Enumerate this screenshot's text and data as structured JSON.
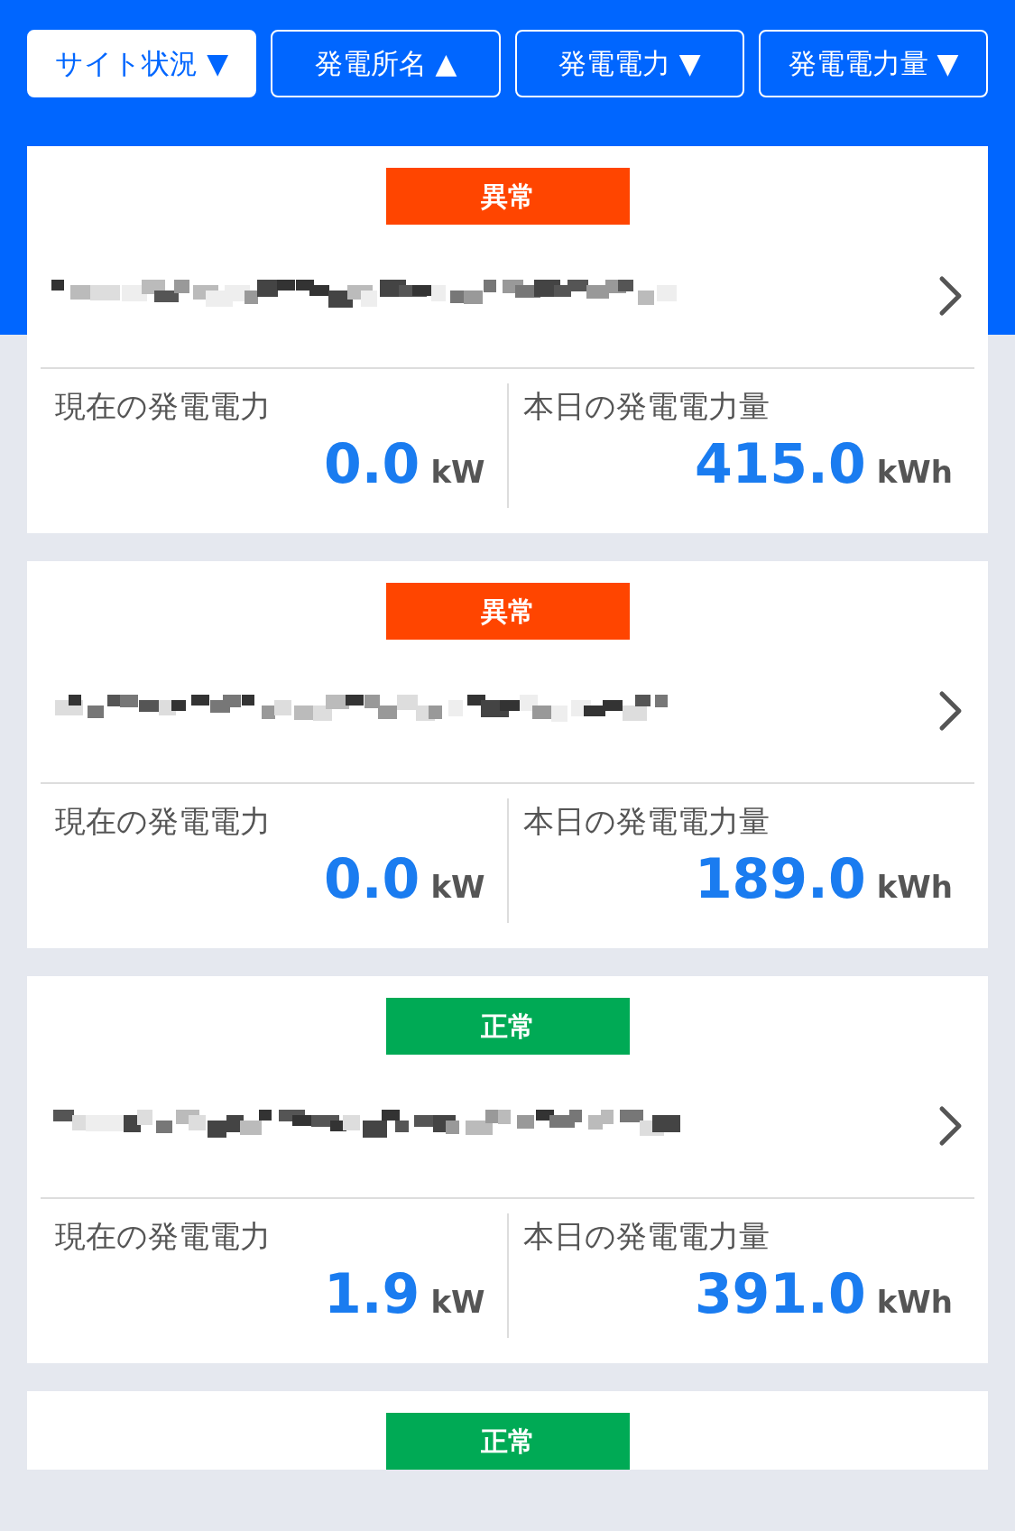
{
  "sort_buttons": [
    {
      "label": "サイト状況",
      "arrow": "▼",
      "selected": true
    },
    {
      "label": "発電所名",
      "arrow": "▲",
      "selected": false
    },
    {
      "label": "発電電力",
      "arrow": "▼",
      "selected": false
    },
    {
      "label": "発電電力量",
      "arrow": "▼",
      "selected": false
    }
  ],
  "sites": [
    {
      "status": {
        "kind": "error",
        "label": "異常"
      },
      "current_label": "現在の発電電力",
      "current_value": "0.0",
      "current_unit": "kW",
      "today_label": "本日の発電電力量",
      "today_value": "415.0",
      "today_unit": "kWh"
    },
    {
      "status": {
        "kind": "error",
        "label": "異常"
      },
      "current_label": "現在の発電電力",
      "current_value": "0.0",
      "current_unit": "kW",
      "today_label": "本日の発電電力量",
      "today_value": "189.0",
      "today_unit": "kWh"
    },
    {
      "status": {
        "kind": "normal",
        "label": "正常"
      },
      "current_label": "現在の発電電力",
      "current_value": "1.9",
      "current_unit": "kW",
      "today_label": "本日の発電電力量",
      "today_value": "391.0",
      "today_unit": "kWh"
    },
    {
      "status": {
        "kind": "normal",
        "label": "正常"
      }
    }
  ]
}
